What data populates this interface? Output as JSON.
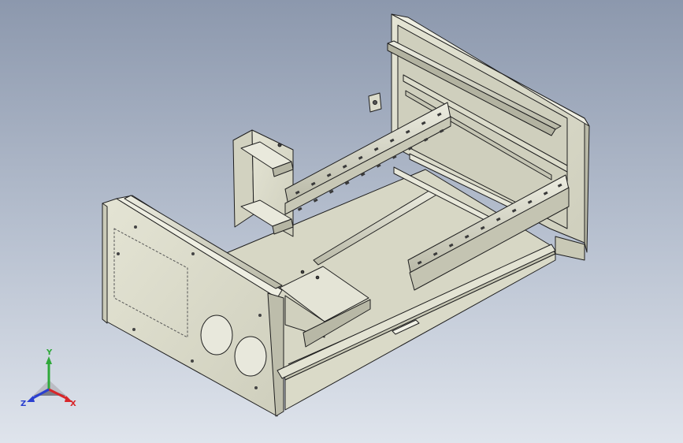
{
  "viewport": {
    "background_top": "#8c98ad",
    "background_bottom": "#dfe4ec"
  },
  "model": {
    "face_color": "#dcdccb",
    "shade_color": "#c3c3b0",
    "dark_color": "#a9a996",
    "edge_color": "#1f1f1f"
  },
  "triad": {
    "y_label": "Y",
    "x_label": "X",
    "z_label": "Z",
    "y_color": "#2fa83a",
    "x_color": "#d8262a",
    "z_color": "#2a3fd0"
  }
}
